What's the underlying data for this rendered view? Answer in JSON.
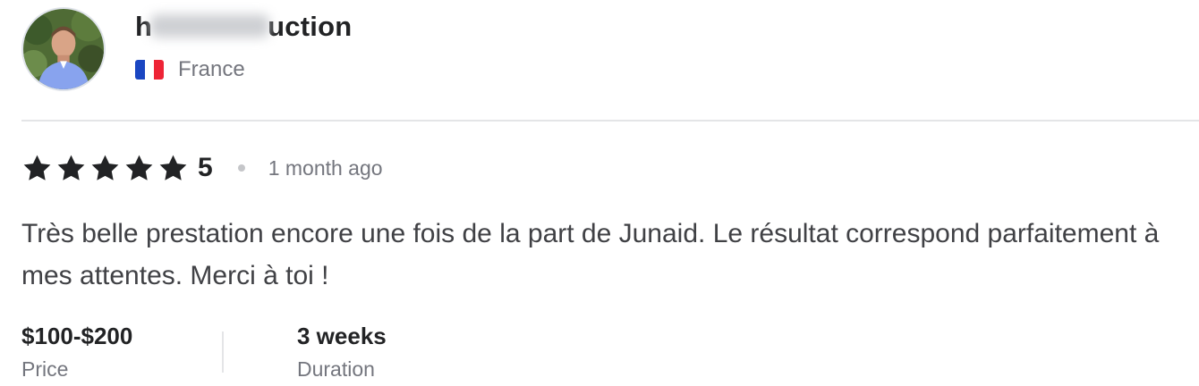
{
  "reviewer": {
    "name_start": "h",
    "name_redacted": "orinprod",
    "name_end": "uction",
    "country": "France",
    "flag_colors": [
      "#1a46c2",
      "#ffffff",
      "#ee2436"
    ]
  },
  "rating": {
    "stars": 5,
    "score": "5",
    "star_color": "#222325",
    "time": "1 month ago"
  },
  "review": {
    "text": "Très belle prestation encore une fois de la part de Junaid. Le résultat correspond parfaitement à mes attentes. Merci à toi !"
  },
  "meta": {
    "price_value": "$100-$200",
    "price_label": "Price",
    "duration_value": "3 weeks",
    "duration_label": "Duration"
  },
  "icons": {
    "avatar": "profile-photo",
    "flag": "france-flag-icon",
    "star": "star-icon"
  }
}
